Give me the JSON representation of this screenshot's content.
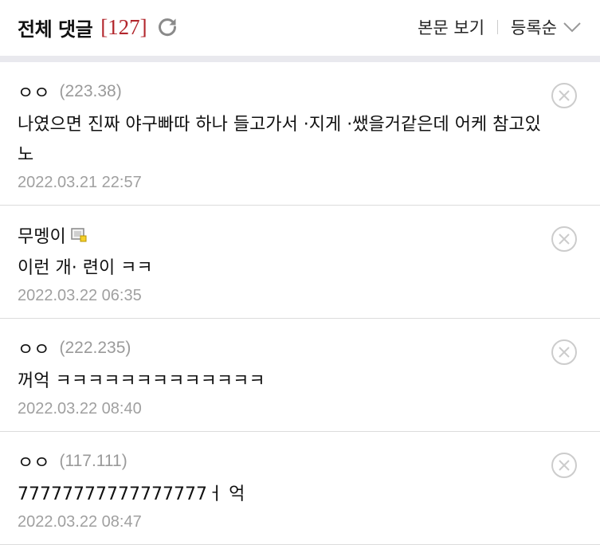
{
  "header": {
    "title": "전체 댓글",
    "count": "[127]",
    "view_body": "본문 보기",
    "sort": "등록순"
  },
  "comments": [
    {
      "author": "ㅇㅇ",
      "ip": "(223.38)",
      "text": "나였으면 진짜 야구빠따 하나 들고가서 ·지게 ·쌨을거같은데 어케 참고있노",
      "date": "2022.03.21 22:57"
    },
    {
      "author": "무멩이",
      "ip": "",
      "text": "이런 개·   련이 ㅋㅋ",
      "date": "2022.03.22 06:35"
    },
    {
      "author": "ㅇㅇ",
      "ip": "(222.235)",
      "text": "꺼억 ㅋㅋㅋㅋㅋㅋㅋㅋㅋㅋㅋㅋㅋ",
      "date": "2022.03.22 08:40"
    },
    {
      "author": "ㅇㅇ",
      "ip": "(117.111)",
      "text": "77777777777777777ㅓ 억",
      "date": "2022.03.22 08:47"
    }
  ],
  "colors": {
    "accent": "#b2262c",
    "meta": "#9a9a9a",
    "divider": "#e9e9ee"
  },
  "icons": {
    "refresh": "refresh-icon",
    "sort": "chevron-down-icon",
    "delete": "close-circle-icon",
    "member": "fixed-member-badge-icon"
  }
}
